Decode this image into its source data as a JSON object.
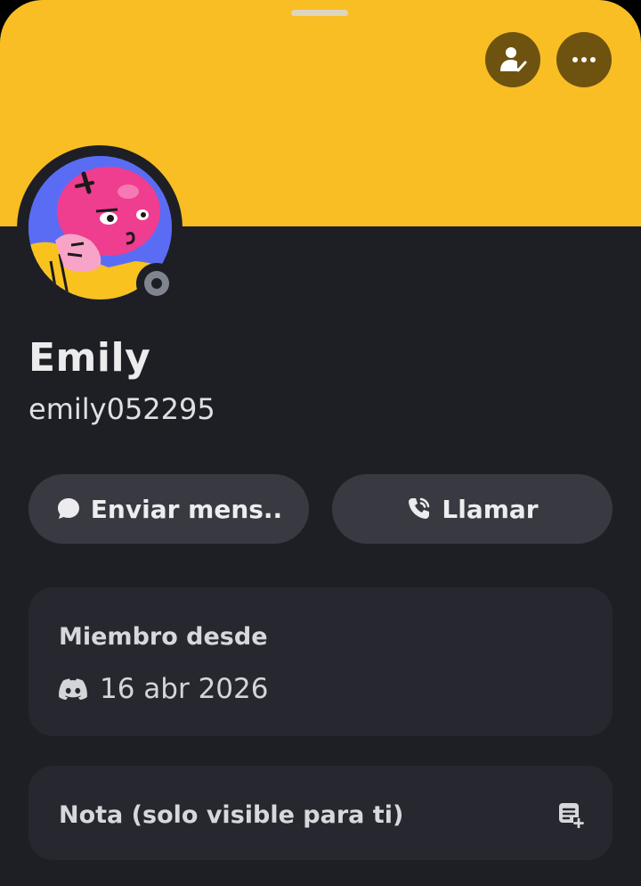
{
  "profile": {
    "display_name": "Emily",
    "username": "emily052295",
    "status": "offline"
  },
  "header": {
    "banner_color": "#f8be24",
    "friend_icon": "person-check-icon",
    "more_icon": "more-horizontal-icon"
  },
  "actions": {
    "message_label": "Enviar mens..",
    "message_icon": "chat-bubble-icon",
    "call_label": "Llamar",
    "call_icon": "phone-call-icon"
  },
  "member_since": {
    "title": "Miembro desde",
    "icon": "discord-logo-icon",
    "date": "16 abr 2026"
  },
  "note": {
    "label": "Nota (solo visible para ti)",
    "icon": "note-add-icon"
  }
}
